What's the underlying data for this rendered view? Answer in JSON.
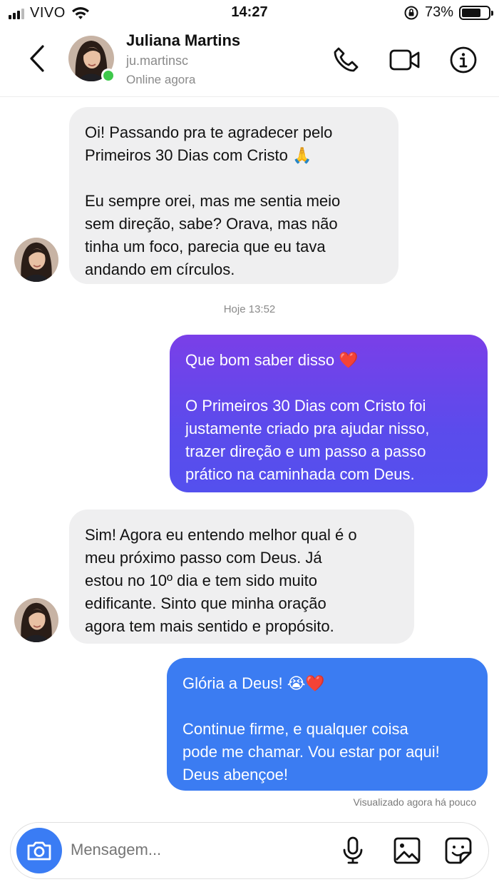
{
  "status_bar": {
    "carrier": "VIVO",
    "time": "14:27",
    "battery": "73%",
    "battery_level": 0.73
  },
  "header": {
    "name": "Juliana Martins",
    "handle": "ju.martinsc",
    "status": "Online agora",
    "icons": [
      "back-arrow-icon",
      "phone-icon",
      "video-camera-icon",
      "info-icon"
    ]
  },
  "messages": [
    {
      "direction": "incoming",
      "paragraphs": [
        [
          "Oi! Passando pra te agradecer pelo",
          "Primeiros 30 Dias com Cristo 🙏"
        ],
        [
          "Eu sempre orei, mas me sentia meio",
          "sem direção, sabe? Orava, mas não",
          "tinha um foco, parecia que eu tava",
          "andando em círculos."
        ]
      ]
    },
    {
      "direction": "outgoing",
      "paragraphs": [
        [
          "Que bom saber disso ❤️"
        ],
        [
          "O Primeiros 30 Dias com Cristo foi",
          "justamente criado pra ajudar nisso,",
          "trazer direção e um passo a passo",
          "prático na caminhada com Deus."
        ]
      ]
    },
    {
      "direction": "incoming",
      "paragraphs": [
        [
          "Sim! Agora eu entendo melhor qual é o",
          "meu próximo passo com Deus. Já",
          "estou no 10º dia e tem sido muito",
          "edificante. Sinto que minha oração",
          "agora tem mais sentido e propósito."
        ]
      ]
    },
    {
      "direction": "outgoing",
      "paragraphs": [
        [
          "Glória a Deus! 😭❤️"
        ],
        [
          "Continue firme, e qualquer coisa",
          "pode me chamar. Vou estar por aqui!",
          "Deus abençoe!"
        ]
      ]
    }
  ],
  "timestamp": "Hoje 13:52",
  "seen_label": "Visualizado agora há pouco",
  "composer": {
    "placeholder": "Mensagem...",
    "icons": [
      "camera-icon",
      "microphone-icon",
      "gallery-icon",
      "sticker-icon"
    ]
  },
  "colors": {
    "accent_blue": "#3a7cf4",
    "outgoing_gradient_start": "#7a3fe8",
    "outgoing_gradient_end": "#5450ee",
    "outgoing_solid": "#3b7cf2",
    "incoming_bubble": "#efeff0",
    "online_green": "#3ec84b"
  }
}
